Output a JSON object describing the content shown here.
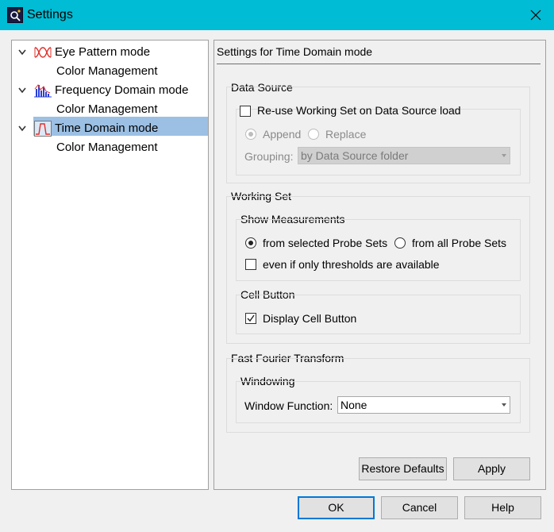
{
  "window": {
    "title": "Settings",
    "close_icon": "close-icon",
    "app_icon": "settings-app-icon"
  },
  "tree": {
    "items": [
      {
        "label": "Eye Pattern mode",
        "icon": "eye-pattern-icon",
        "child": "Color Management",
        "expanded": true
      },
      {
        "label": "Frequency Domain mode",
        "icon": "frequency-domain-icon",
        "child": "Color Management",
        "expanded": true
      },
      {
        "label": "Time Domain mode",
        "icon": "time-domain-icon",
        "child": "Color Management",
        "expanded": true,
        "selected": true
      }
    ]
  },
  "panel": {
    "title": "Settings for Time Domain mode",
    "data_source": {
      "title": "Data Source",
      "reuse_label": "Re-use Working Set on Data Source load",
      "reuse_checked": false,
      "append_label": "Append",
      "replace_label": "Replace",
      "append_selected": true,
      "grouping_label": "Grouping:",
      "grouping_value": "by Data Source folder"
    },
    "working_set": {
      "title": "Working Set",
      "show_measurements": {
        "title": "Show Measurements",
        "selected_label": "from selected Probe Sets",
        "all_label": "from all Probe Sets",
        "selected_option": "from selected Probe Sets",
        "thresholds_label": "even if only thresholds are available",
        "thresholds_checked": false
      },
      "cell_button": {
        "title": "Cell Button",
        "display_label": "Display Cell Button",
        "display_checked": true
      }
    },
    "fft": {
      "title": "Fast Fourier Transform",
      "windowing": {
        "title": "Windowing",
        "function_label": "Window Function:",
        "function_value": "None"
      }
    },
    "restore_label": "Restore Defaults",
    "apply_label": "Apply"
  },
  "footer": {
    "ok_label": "OK",
    "cancel_label": "Cancel",
    "help_label": "Help"
  },
  "colors": {
    "titlebar": "#00bcd4",
    "selection": "#9cc0e4",
    "default_button_border": "#0078d7"
  }
}
